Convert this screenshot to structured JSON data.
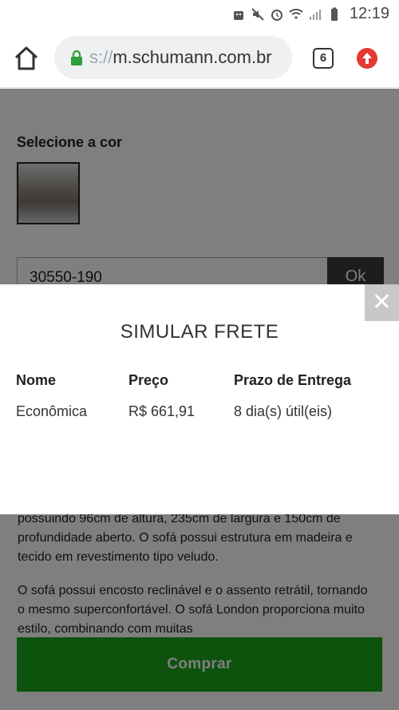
{
  "status_bar": {
    "time": "12:19"
  },
  "browser": {
    "url_scheme": "s://",
    "url_host": "m.schumann.com.br",
    "tab_count": "6",
    "accent_colors": {
      "lock": "#2e9e3a",
      "update": "#e53935"
    }
  },
  "page": {
    "select_color_label": "Selecione a cor",
    "cep_value": "30550-190",
    "ok_label": "Ok",
    "description_1": "possuindo 96cm de altura, 235cm de largura e 150cm de profundidade aberto. O sofá possui estrutura em madeira e tecido em revestimento tipo veludo.",
    "description_2": "O sofá possui encosto reclinável e o assento retrátil, tornando o mesmo superconfortável. O sofá London proporciona muito estilo, combinando com muitas",
    "buy_label": "Comprar",
    "buy_color": "#1aa51a"
  },
  "modal": {
    "close_label": "✕",
    "title": "SIMULAR FRETE",
    "headers": [
      "Nome",
      "Preço",
      "Prazo de Entrega"
    ],
    "rows": [
      [
        "Econômica",
        "R$ 661,91",
        "8 dia(s) útil(eis)"
      ]
    ]
  }
}
